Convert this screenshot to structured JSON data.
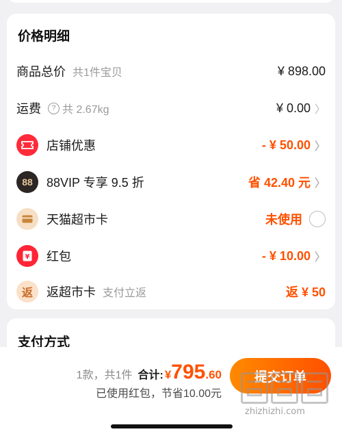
{
  "price_detail": {
    "title": "价格明细",
    "rows": [
      {
        "label": "商品总价",
        "sub": "共1件宝贝",
        "value": "¥ 898.00"
      },
      {
        "label": "运费",
        "sub": "共 2.67kg",
        "value": "¥ 0.00"
      },
      {
        "label": "店铺优惠",
        "value": "- ¥ 50.00",
        "icon_glyph": "▭"
      },
      {
        "label": "88VIP 专享 9.5 折",
        "value": "省 42.40 元",
        "icon_glyph": "88"
      },
      {
        "label": "天猫超市卡",
        "value": "未使用",
        "icon_glyph": "▬"
      },
      {
        "label": "红包",
        "value": "- ¥ 10.00",
        "icon_glyph": "¥"
      },
      {
        "label": "返超市卡",
        "sub": "支付立返",
        "value": "返 ¥ 50",
        "icon_glyph": "返"
      }
    ]
  },
  "payment": {
    "title": "支付方式"
  },
  "bottom": {
    "count": "1款，共1件",
    "total_label": "合计:",
    "yen": "¥",
    "total_int": "795",
    "total_dec": ".60",
    "savings": "已使用红包，节省10.00元",
    "submit_label": "提交订单"
  },
  "watermark": {
    "text": "zhizhizhi.com"
  },
  "colors": {
    "accent": "#ff5000",
    "button_start": "#ff8a00",
    "button_end": "#ff4f00"
  }
}
